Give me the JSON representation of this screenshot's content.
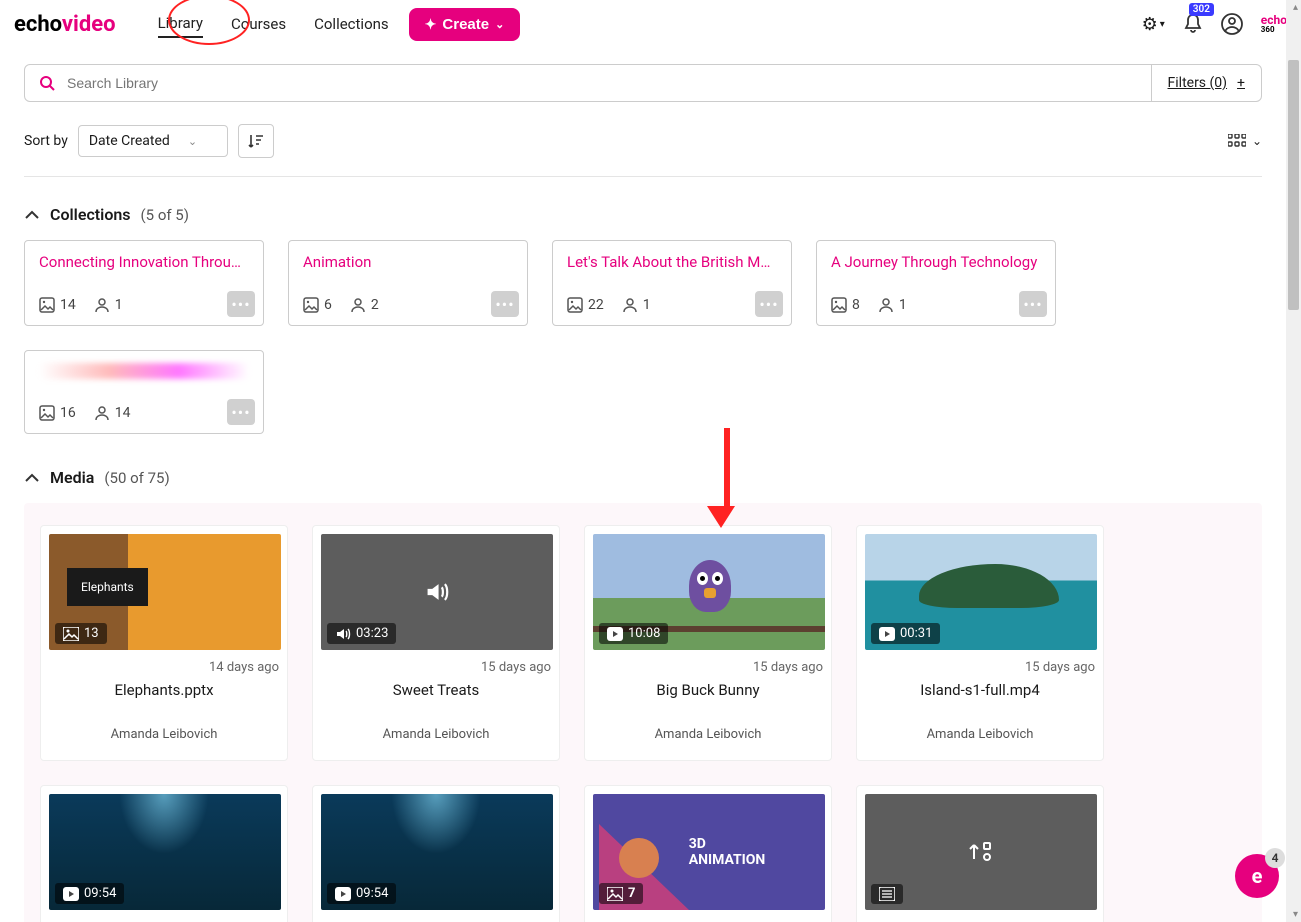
{
  "logo": {
    "part1": "echo",
    "part2": "video"
  },
  "nav": {
    "library": "Library",
    "courses": "Courses",
    "collections": "Collections"
  },
  "create_btn": "Create",
  "notifications": {
    "count": "302"
  },
  "echo360": {
    "top": "echo",
    "sub": "360"
  },
  "search": {
    "placeholder": "Search Library"
  },
  "filters": "Filters (0)",
  "sort": {
    "label": "Sort by",
    "value": "Date Created"
  },
  "sections": {
    "collections": {
      "title": "Collections",
      "count": "(5 of 5)"
    },
    "media": {
      "title": "Media",
      "count": "(50 of 75)"
    }
  },
  "collections": [
    {
      "title": "Connecting Innovation Throug...",
      "items": "14",
      "members": "1"
    },
    {
      "title": "Animation",
      "items": "6",
      "members": "2"
    },
    {
      "title": "Let's Talk About the British Mo...",
      "items": "22",
      "members": "1"
    },
    {
      "title": "A Journey Through Technology",
      "items": "8",
      "members": "1"
    },
    {
      "title": "",
      "items": "16",
      "members": "14",
      "blurred": true
    }
  ],
  "media": [
    {
      "badge_icon": "image",
      "badge_text": "13",
      "timestamp": "14 days ago",
      "title": "Elephants.pptx",
      "owner": "Amanda Leibovich",
      "thumb": "orange",
      "thumb_label": "Elephants"
    },
    {
      "badge_icon": "audio",
      "badge_text": "03:23",
      "timestamp": "15 days ago",
      "title": "Sweet Treats",
      "owner": "Amanda Leibovich",
      "thumb": "gray"
    },
    {
      "badge_icon": "video",
      "badge_text": "10:08",
      "timestamp": "15 days ago",
      "title": "Big Buck Bunny",
      "owner": "Amanda Leibovich",
      "thumb": "bunny"
    },
    {
      "badge_icon": "video",
      "badge_text": "00:31",
      "timestamp": "15 days ago",
      "title": "Island-s1-full.mp4",
      "owner": "Amanda Leibovich",
      "thumb": "island"
    },
    {
      "badge_icon": "video",
      "badge_text": "09:54",
      "timestamp": "",
      "title": "",
      "owner": "",
      "thumb": "underwater"
    },
    {
      "badge_icon": "video",
      "badge_text": "09:54",
      "timestamp": "",
      "title": "",
      "owner": "",
      "thumb": "underwater"
    },
    {
      "badge_icon": "image",
      "badge_text": "7",
      "timestamp": "",
      "title": "",
      "owner": "",
      "thumb": "3d",
      "thumb_label": "3D\nANIMATION"
    },
    {
      "badge_icon": "list",
      "badge_text": "",
      "timestamp": "",
      "title": "",
      "owner": "",
      "thumb": "upload"
    }
  ],
  "widget": {
    "count": "4",
    "letter": "e"
  }
}
